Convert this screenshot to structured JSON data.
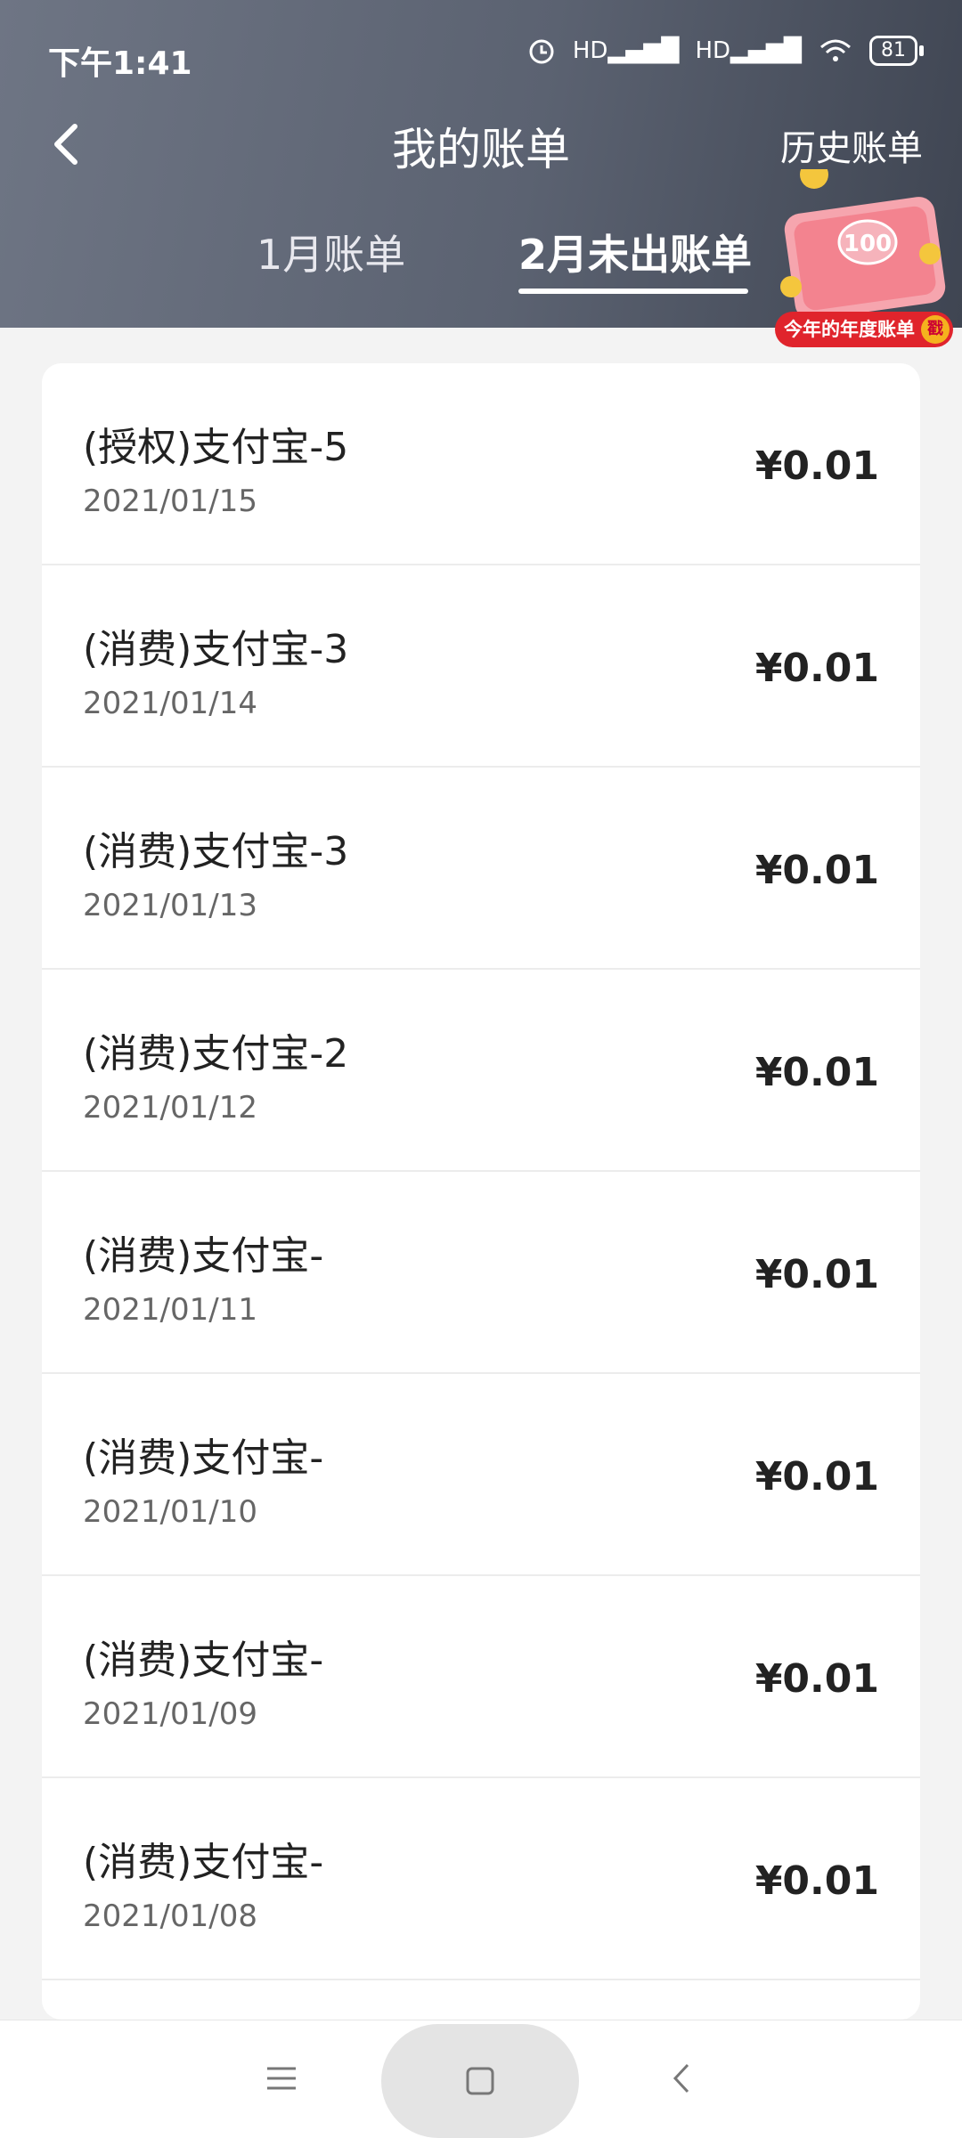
{
  "status_bar": {
    "time": "下午1:41",
    "network_1": "HD",
    "network_2": "HD",
    "battery": "81"
  },
  "header": {
    "title": "我的账单",
    "history_label": "历史账单"
  },
  "tabs": [
    {
      "label": "1月账单",
      "active": false
    },
    {
      "label": "2月未出账单",
      "active": true
    }
  ],
  "promo": {
    "amount_text": "100",
    "label": "今年的年度账单",
    "badge": "戳"
  },
  "transactions": [
    {
      "title": "(授权)支付宝-5",
      "date": "2021/01/15",
      "amount": "¥0.01"
    },
    {
      "title": "(消费)支付宝-3",
      "date": "2021/01/14",
      "amount": "¥0.01"
    },
    {
      "title": "(消费)支付宝-3",
      "date": "2021/01/13",
      "amount": "¥0.01"
    },
    {
      "title": "(消费)支付宝-2",
      "date": "2021/01/12",
      "amount": "¥0.01"
    },
    {
      "title": "(消费)支付宝-",
      "date": "2021/01/11",
      "amount": "¥0.01"
    },
    {
      "title": "(消费)支付宝-",
      "date": "2021/01/10",
      "amount": "¥0.01"
    },
    {
      "title": "(消费)支付宝-",
      "date": "2021/01/09",
      "amount": "¥0.01"
    },
    {
      "title": "(消费)支付宝-",
      "date": "2021/01/08",
      "amount": "¥0.01"
    }
  ],
  "colors": {
    "header_bg": "#5b6271",
    "badge_red": "#e0242c",
    "badge_gold": "#f5b21e"
  },
  "icons": {
    "back": "chevron-left-icon",
    "menu": "menu-icon",
    "home": "home-square-icon",
    "nav_back": "nav-back-icon"
  }
}
